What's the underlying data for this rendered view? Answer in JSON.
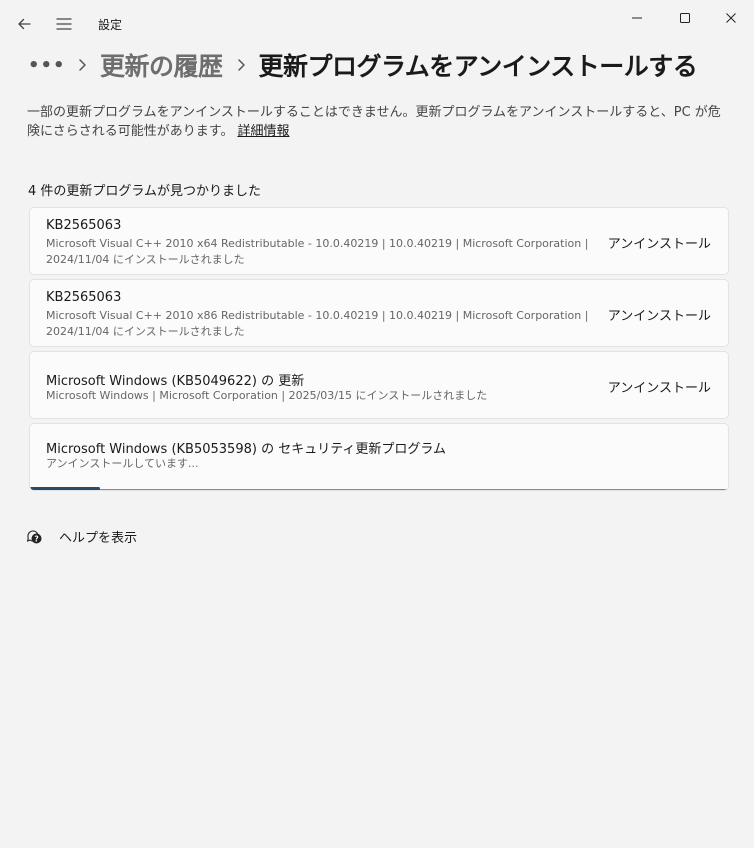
{
  "window": {
    "title": "設定"
  },
  "breadcrumb": {
    "more": "•••",
    "parent": "更新の履歴",
    "current": "更新プログラムをアンインストールする"
  },
  "description": {
    "text": "一部の更新プログラムをアンインストールすることはできません。更新プログラムをアンインストールすると、PC が危険にさらされる可能性があります。",
    "link": "詳細情報"
  },
  "count_label": "4 件の更新プログラムが見つかりました",
  "updates": [
    {
      "title": "KB2565063",
      "meta_line1": "Microsoft Visual C++ 2010  x64 Redistributable - 10.0.40219  |  10.0.40219  |  Microsoft Corporation  |",
      "meta_line2": "2024/11/04 にインストールされました",
      "action": "アンインストール"
    },
    {
      "title": "KB2565063",
      "meta_line1": "Microsoft Visual C++ 2010  x86 Redistributable - 10.0.40219  |  10.0.40219  |  Microsoft Corporation  |",
      "meta_line2": "2024/11/04 にインストールされました",
      "action": "アンインストール"
    },
    {
      "title": "Microsoft Windows (KB5049622) の 更新",
      "meta_line1": "Microsoft Windows  |  Microsoft Corporation  |  2025/03/15 にインストールされました",
      "action": "アンインストール"
    },
    {
      "title": "Microsoft Windows (KB5053598) の セキュリティ更新プログラム",
      "status": "アンインストールしています...",
      "progress": 0.1
    }
  ],
  "help": {
    "label": "ヘルプを表示",
    "icon": "help-chat-icon"
  },
  "colors": {
    "background": "#f3f3f3",
    "card": "#fbfbfb",
    "progress_fill": "#2b4a66"
  }
}
